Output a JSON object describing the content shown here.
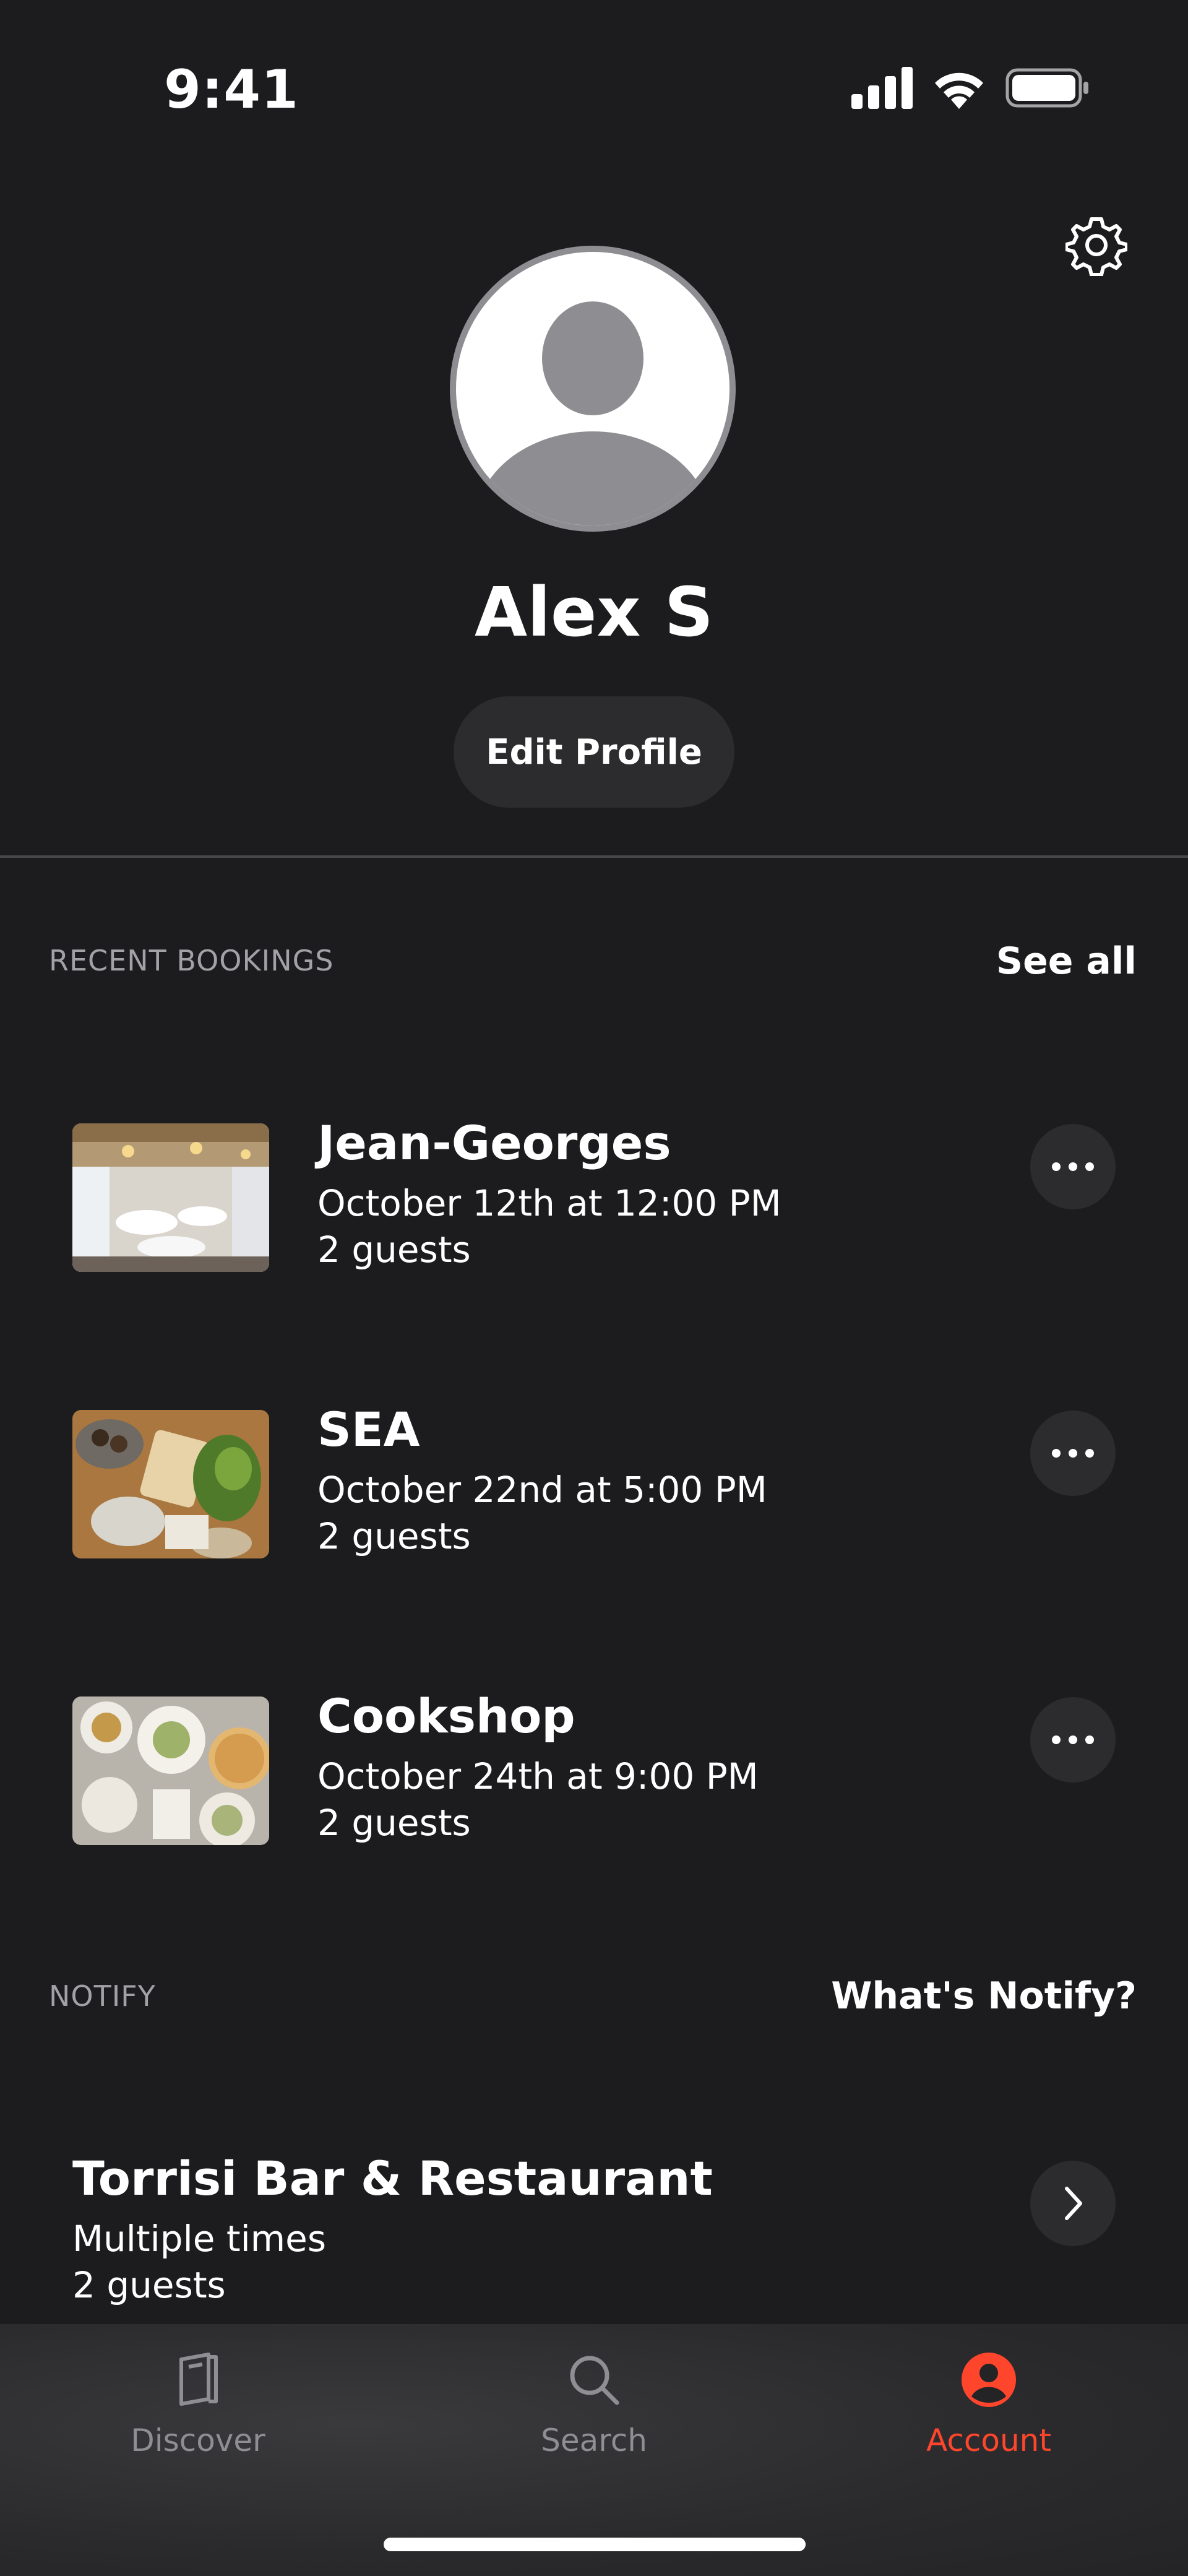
{
  "status_bar": {
    "time": "9:41"
  },
  "profile": {
    "name": "Alex S",
    "edit_label": "Edit Profile"
  },
  "recent_bookings": {
    "section_label": "RECENT BOOKINGS",
    "link_label": "See all",
    "items": [
      {
        "name": "Jean-Georges",
        "date": "October 12th at 12:00 PM",
        "guests": "2 guests"
      },
      {
        "name": "SEA",
        "date": "October 22nd at 5:00 PM",
        "guests": "2 guests"
      },
      {
        "name": "Cookshop",
        "date": "October 24th at 9:00 PM",
        "guests": "2 guests"
      }
    ]
  },
  "notify": {
    "section_label": "NOTIFY",
    "link_label": "What's Notify?",
    "items": [
      {
        "name": "Torrisi Bar & Restaurant",
        "times": "Multiple times",
        "guests": "2 guests"
      }
    ]
  },
  "tabbar": {
    "tabs": [
      {
        "label": "Discover",
        "icon": "discover-icon"
      },
      {
        "label": "Search",
        "icon": "search-icon"
      },
      {
        "label": "Account",
        "icon": "account-icon",
        "active": true
      }
    ]
  },
  "colors": {
    "background": "#1c1c1e",
    "accent": "#ff462d",
    "button_bg": "#2c2c2e",
    "secondary_text": "#a1a1a6"
  }
}
